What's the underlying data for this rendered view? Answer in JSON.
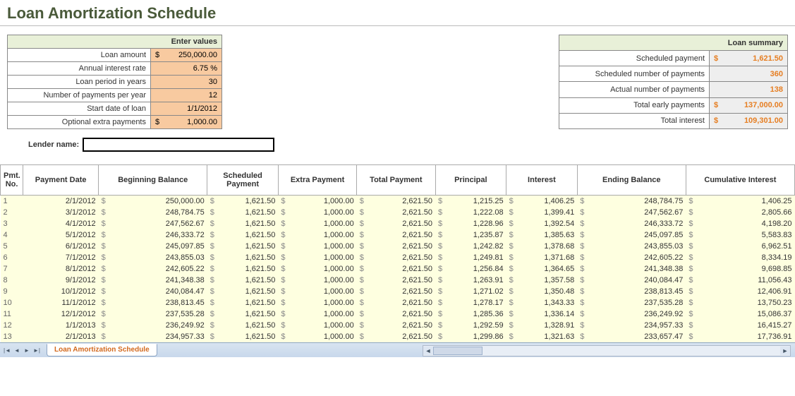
{
  "title": "Loan Amortization Schedule",
  "enter": {
    "header": "Enter values",
    "rows": [
      {
        "label": "Loan amount",
        "currency": "$",
        "value": "250,000.00"
      },
      {
        "label": "Annual interest rate",
        "currency": "",
        "value": "6.75  %"
      },
      {
        "label": "Loan period in years",
        "currency": "",
        "value": "30"
      },
      {
        "label": "Number of payments per year",
        "currency": "",
        "value": "12"
      },
      {
        "label": "Start date of loan",
        "currency": "",
        "value": "1/1/2012"
      },
      {
        "label": "Optional extra payments",
        "currency": "$",
        "value": "1,000.00"
      }
    ]
  },
  "summary": {
    "header": "Loan summary",
    "rows": [
      {
        "label": "Scheduled payment",
        "currency": "$",
        "value": "1,621.50"
      },
      {
        "label": "Scheduled number of payments",
        "currency": "",
        "value": "360"
      },
      {
        "label": "Actual number of payments",
        "currency": "",
        "value": "138"
      },
      {
        "label": "Total early payments",
        "currency": "$",
        "value": "137,000.00"
      },
      {
        "label": "Total interest",
        "currency": "$",
        "value": "109,301.00"
      }
    ]
  },
  "lender": {
    "label": "Lender name:",
    "value": ""
  },
  "schedule": {
    "headers": [
      "Pmt. No.",
      "Payment Date",
      "Beginning Balance",
      "Scheduled Payment",
      "Extra Payment",
      "Total Payment",
      "Principal",
      "Interest",
      "Ending Balance",
      "Cumulative Interest"
    ],
    "rows": [
      {
        "no": "1",
        "date": "2/1/2012",
        "bb": "250,000.00",
        "sp": "1,621.50",
        "ep": "1,000.00",
        "tp": "2,621.50",
        "pr": "1,215.25",
        "in": "1,406.25",
        "eb": "248,784.75",
        "ci": "1,406.25"
      },
      {
        "no": "2",
        "date": "3/1/2012",
        "bb": "248,784.75",
        "sp": "1,621.50",
        "ep": "1,000.00",
        "tp": "2,621.50",
        "pr": "1,222.08",
        "in": "1,399.41",
        "eb": "247,562.67",
        "ci": "2,805.66"
      },
      {
        "no": "3",
        "date": "4/1/2012",
        "bb": "247,562.67",
        "sp": "1,621.50",
        "ep": "1,000.00",
        "tp": "2,621.50",
        "pr": "1,228.96",
        "in": "1,392.54",
        "eb": "246,333.72",
        "ci": "4,198.20"
      },
      {
        "no": "4",
        "date": "5/1/2012",
        "bb": "246,333.72",
        "sp": "1,621.50",
        "ep": "1,000.00",
        "tp": "2,621.50",
        "pr": "1,235.87",
        "in": "1,385.63",
        "eb": "245,097.85",
        "ci": "5,583.83"
      },
      {
        "no": "5",
        "date": "6/1/2012",
        "bb": "245,097.85",
        "sp": "1,621.50",
        "ep": "1,000.00",
        "tp": "2,621.50",
        "pr": "1,242.82",
        "in": "1,378.68",
        "eb": "243,855.03",
        "ci": "6,962.51"
      },
      {
        "no": "6",
        "date": "7/1/2012",
        "bb": "243,855.03",
        "sp": "1,621.50",
        "ep": "1,000.00",
        "tp": "2,621.50",
        "pr": "1,249.81",
        "in": "1,371.68",
        "eb": "242,605.22",
        "ci": "8,334.19"
      },
      {
        "no": "7",
        "date": "8/1/2012",
        "bb": "242,605.22",
        "sp": "1,621.50",
        "ep": "1,000.00",
        "tp": "2,621.50",
        "pr": "1,256.84",
        "in": "1,364.65",
        "eb": "241,348.38",
        "ci": "9,698.85"
      },
      {
        "no": "8",
        "date": "9/1/2012",
        "bb": "241,348.38",
        "sp": "1,621.50",
        "ep": "1,000.00",
        "tp": "2,621.50",
        "pr": "1,263.91",
        "in": "1,357.58",
        "eb": "240,084.47",
        "ci": "11,056.43"
      },
      {
        "no": "9",
        "date": "10/1/2012",
        "bb": "240,084.47",
        "sp": "1,621.50",
        "ep": "1,000.00",
        "tp": "2,621.50",
        "pr": "1,271.02",
        "in": "1,350.48",
        "eb": "238,813.45",
        "ci": "12,406.91"
      },
      {
        "no": "10",
        "date": "11/1/2012",
        "bb": "238,813.45",
        "sp": "1,621.50",
        "ep": "1,000.00",
        "tp": "2,621.50",
        "pr": "1,278.17",
        "in": "1,343.33",
        "eb": "237,535.28",
        "ci": "13,750.23"
      },
      {
        "no": "11",
        "date": "12/1/2012",
        "bb": "237,535.28",
        "sp": "1,621.50",
        "ep": "1,000.00",
        "tp": "2,621.50",
        "pr": "1,285.36",
        "in": "1,336.14",
        "eb": "236,249.92",
        "ci": "15,086.37"
      },
      {
        "no": "12",
        "date": "1/1/2013",
        "bb": "236,249.92",
        "sp": "1,621.50",
        "ep": "1,000.00",
        "tp": "2,621.50",
        "pr": "1,292.59",
        "in": "1,328.91",
        "eb": "234,957.33",
        "ci": "16,415.27"
      },
      {
        "no": "13",
        "date": "2/1/2013",
        "bb": "234,957.33",
        "sp": "1,621.50",
        "ep": "1,000.00",
        "tp": "2,621.50",
        "pr": "1,299.86",
        "in": "1,321.63",
        "eb": "233,657.47",
        "ci": "17,736.91"
      }
    ]
  },
  "tab": {
    "sheet": "Loan Amortization Schedule"
  }
}
